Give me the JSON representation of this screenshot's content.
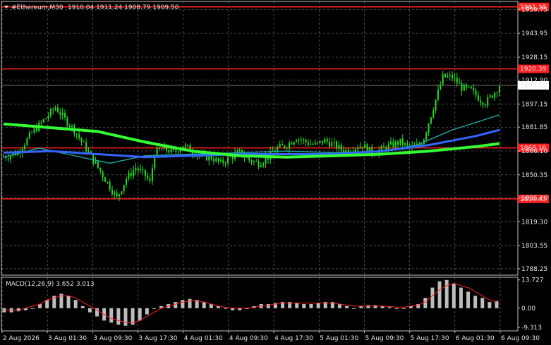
{
  "header": {
    "symbol_timeframe": "#Ethereum,M30",
    "ohlc": "1910.04 1911.24 1908.79 1909.50"
  },
  "colors": {
    "background": "#000000",
    "grid": "#c0c0c0",
    "candle": "#22dd22",
    "level_line": "#ff2020",
    "ma_green": "#33ff33",
    "ma_blue": "#3366ff",
    "ma_teal": "#20a0a0",
    "macd_hist": "#bdbdbd",
    "macd_signal": "#ff2020"
  },
  "chart_data": {
    "type": "candlestick",
    "price_axis": {
      "ticks": [
        "1959.75",
        "1943.95",
        "1928.15",
        "1912.90",
        "1897.15",
        "1881.85",
        "1866.10",
        "1850.35",
        "1835.10",
        "1819.30",
        "1803.55",
        "1788.25"
      ],
      "range": [
        1784,
        1965
      ]
    },
    "time_axis": {
      "labels": [
        "2 Aug 2026",
        "3 Aug 01:30",
        "3 Aug 09:30",
        "3 Aug 17:30",
        "4 Aug 01:30",
        "4 Aug 09:30",
        "4 Aug 17:30",
        "5 Aug 01:30",
        "5 Aug 09:30",
        "5 Aug 17:30",
        "6 Aug 01:30",
        "6 Aug 09:30"
      ]
    },
    "levels": [
      {
        "label": "1961.38",
        "value": 1961.38
      },
      {
        "label": "1920.39",
        "value": 1920.39
      },
      {
        "label": "1868.16",
        "value": 1868.16
      },
      {
        "label": "1834.43",
        "value": 1834.43
      }
    ],
    "current_price": {
      "label": "1909.50",
      "value": 1909.5
    },
    "close_path": [
      [
        0,
        1862
      ],
      [
        6,
        1865
      ],
      [
        12,
        1878
      ],
      [
        18,
        1888
      ],
      [
        22,
        1895
      ],
      [
        26,
        1887
      ],
      [
        30,
        1880
      ],
      [
        34,
        1870
      ],
      [
        38,
        1860
      ],
      [
        42,
        1850
      ],
      [
        46,
        1840
      ],
      [
        48,
        1835
      ],
      [
        52,
        1848
      ],
      [
        56,
        1855
      ],
      [
        60,
        1850
      ],
      [
        62,
        1845
      ],
      [
        64,
        1865
      ],
      [
        68,
        1868
      ],
      [
        72,
        1865
      ],
      [
        76,
        1870
      ],
      [
        80,
        1866
      ],
      [
        84,
        1862
      ],
      [
        88,
        1862
      ],
      [
        92,
        1858
      ],
      [
        96,
        1862
      ],
      [
        100,
        1865
      ],
      [
        104,
        1860
      ],
      [
        108,
        1858
      ],
      [
        112,
        1862
      ],
      [
        116,
        1868
      ],
      [
        120,
        1870
      ],
      [
        124,
        1875
      ],
      [
        128,
        1872
      ],
      [
        132,
        1870
      ],
      [
        136,
        1873
      ],
      [
        140,
        1870
      ],
      [
        144,
        1866
      ],
      [
        148,
        1868
      ],
      [
        152,
        1870
      ],
      [
        156,
        1865
      ],
      [
        160,
        1867
      ],
      [
        164,
        1870
      ],
      [
        168,
        1872
      ],
      [
        172,
        1868
      ],
      [
        176,
        1870
      ],
      [
        178,
        1875
      ],
      [
        182,
        1895
      ],
      [
        186,
        1915
      ],
      [
        190,
        1915
      ],
      [
        194,
        1908
      ],
      [
        198,
        1906
      ],
      [
        202,
        1900
      ],
      [
        204,
        1898
      ],
      [
        208,
        1905
      ],
      [
        210,
        1909.5
      ]
    ],
    "ma_green": [
      [
        0,
        1884
      ],
      [
        40,
        1879
      ],
      [
        60,
        1872
      ],
      [
        80,
        1866
      ],
      [
        100,
        1863
      ],
      [
        120,
        1862
      ],
      [
        140,
        1863
      ],
      [
        160,
        1864
      ],
      [
        180,
        1866
      ],
      [
        200,
        1869
      ],
      [
        210,
        1871
      ]
    ],
    "ma_blue": [
      [
        0,
        1865
      ],
      [
        20,
        1866
      ],
      [
        40,
        1864
      ],
      [
        60,
        1862
      ],
      [
        80,
        1863
      ],
      [
        100,
        1864
      ],
      [
        120,
        1864
      ],
      [
        140,
        1864
      ],
      [
        160,
        1866
      ],
      [
        180,
        1870
      ],
      [
        200,
        1876
      ],
      [
        210,
        1880
      ]
    ],
    "ma_teal": [
      [
        0,
        1862
      ],
      [
        15,
        1868
      ],
      [
        30,
        1863
      ],
      [
        45,
        1858
      ],
      [
        60,
        1863
      ],
      [
        80,
        1864
      ],
      [
        100,
        1865
      ],
      [
        120,
        1866
      ],
      [
        140,
        1865
      ],
      [
        160,
        1866
      ],
      [
        175,
        1870
      ],
      [
        190,
        1880
      ],
      [
        210,
        1890
      ]
    ],
    "macd": {
      "label": "MACD(12,26,9) 3.652 3.013",
      "ticks": [
        "13.727",
        "0.00",
        "-9.313"
      ],
      "range": [
        -11,
        15
      ],
      "hist": [
        -2,
        -2,
        -1.5,
        -1,
        0,
        2,
        4,
        6,
        7,
        6,
        4,
        1,
        -2,
        -4,
        -6,
        -7,
        -8,
        -8.5,
        -8,
        -6,
        -3,
        0,
        1,
        2,
        3,
        4,
        4.5,
        4,
        3,
        2,
        1,
        0,
        -1,
        -1,
        0,
        1,
        2,
        2,
        2.5,
        3,
        3,
        2.5,
        2,
        2,
        2.5,
        3,
        3,
        2,
        1,
        0,
        1,
        1.5,
        1.5,
        1,
        0.5,
        0,
        0,
        1,
        2,
        5,
        10,
        13,
        13.7,
        12,
        10,
        8,
        6,
        5,
        3,
        3.5
      ],
      "signal": [
        -1,
        -1,
        -1,
        0,
        1,
        2,
        4,
        5,
        6,
        6,
        5,
        3,
        1,
        -1,
        -3,
        -5,
        -6,
        -7,
        -7,
        -6,
        -4,
        -2,
        0,
        1,
        2,
        3,
        3.5,
        3.5,
        3,
        2,
        1,
        0.5,
        0,
        0,
        0,
        0.5,
        1,
        1.5,
        2,
        2.5,
        2.5,
        2.5,
        2.5,
        2.5,
        2.5,
        2.5,
        2.5,
        2,
        1.5,
        1,
        1,
        1,
        1,
        1,
        0.8,
        0.5,
        0.5,
        1,
        1.5,
        3,
        6,
        9,
        11,
        12,
        11,
        10,
        8,
        6,
        4,
        3
      ]
    }
  }
}
